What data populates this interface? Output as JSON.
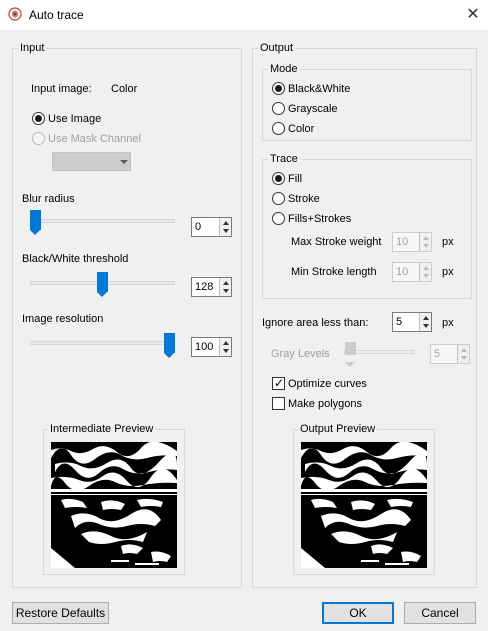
{
  "window": {
    "title": "Auto trace"
  },
  "input": {
    "group_label": "Input",
    "input_image_label": "Input image:",
    "input_image_value": "Color",
    "use_image_label": "Use Image",
    "use_mask_label": "Use Mask Channel",
    "blur": {
      "label": "Blur radius",
      "value": "0",
      "fraction": 0.0
    },
    "bw_threshold": {
      "label": "Black/White threshold",
      "value": "128",
      "fraction": 0.5
    },
    "resolution": {
      "label": "Image resolution",
      "value": "100",
      "fraction": 1.0
    },
    "preview_label": "Intermediate Preview"
  },
  "output": {
    "group_label": "Output",
    "mode": {
      "label": "Mode",
      "options": [
        "Black&White",
        "Grayscale",
        "Color"
      ],
      "selected": "Black&White"
    },
    "trace": {
      "label": "Trace",
      "options": [
        "Fill",
        "Stroke",
        "Fills+Strokes"
      ],
      "selected": "Fill",
      "max_stroke_weight_label": "Max Stroke weight",
      "max_stroke_weight_value": "10",
      "min_stroke_length_label": "Min Stroke length",
      "min_stroke_length_value": "10",
      "unit": "px"
    },
    "ignore_area_label": "Ignore area less than:",
    "ignore_area_value": "5",
    "ignore_area_unit": "px",
    "gray_levels_label": "Gray Levels",
    "gray_levels_value": "5",
    "optimize_curves_label": "Optimize curves",
    "optimize_curves_checked": true,
    "make_polygons_label": "Make polygons",
    "make_polygons_checked": false,
    "preview_label": "Output Preview"
  },
  "buttons": {
    "restore_defaults": "Restore Defaults",
    "ok": "OK",
    "cancel": "Cancel"
  },
  "colors": {
    "accent": "#0078d7",
    "window_bg": "#f0f0f0"
  }
}
